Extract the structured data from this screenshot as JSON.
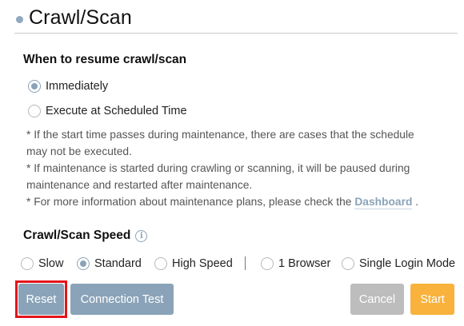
{
  "header": {
    "title": "Crawl/Scan"
  },
  "resume": {
    "title": "When to resume crawl/scan",
    "options": [
      {
        "label": "Immediately",
        "checked": true
      },
      {
        "label": "Execute at Scheduled Time",
        "checked": false
      }
    ]
  },
  "notes": {
    "line1": "* If the start time passes during maintenance, there are cases that the schedule",
    "line2": "may not be executed.",
    "line3": "* If maintenance is started during crawling or scanning, it will be paused during",
    "line4": "maintenance and restarted after maintenance.",
    "line5_prefix": "* For more information about maintenance plans, please check the ",
    "line5_link": "Dashboard",
    "line5_suffix": " ."
  },
  "speed": {
    "title": "Crawl/Scan Speed",
    "info_icon": "info-icon",
    "options": [
      {
        "label": "Slow",
        "checked": false
      },
      {
        "label": "Standard",
        "checked": true
      },
      {
        "label": "High Speed",
        "checked": false
      },
      {
        "label": "1 Browser",
        "checked": false
      },
      {
        "label": "Single Login Mode",
        "checked": false
      }
    ]
  },
  "buttons": {
    "reset": "Reset",
    "connection_test": "Connection Test",
    "cancel": "Cancel",
    "start": "Start"
  },
  "colors": {
    "accent": "#8aa3b8",
    "start": "#f9b23c",
    "cancel": "#bdbdbd",
    "highlight": "#e3141b"
  }
}
